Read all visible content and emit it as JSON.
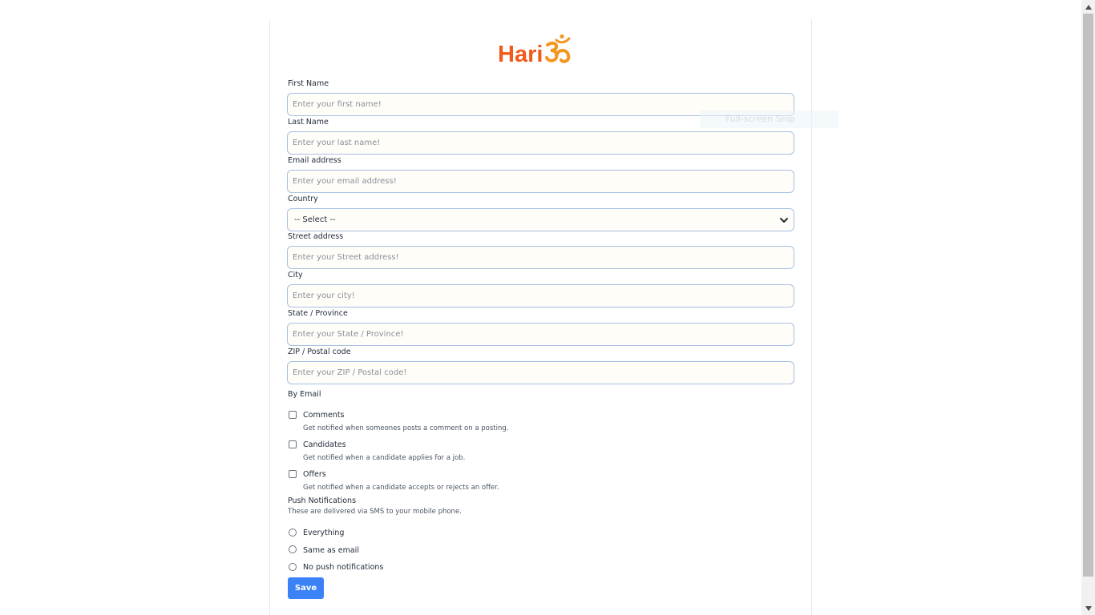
{
  "brand": {
    "name": "Hari",
    "symbol": "om-symbol",
    "color": "#f05a1a",
    "symbol_color": "#f4961e"
  },
  "form": {
    "first_name": {
      "label": "First Name",
      "placeholder": "Enter your first name!"
    },
    "last_name": {
      "label": "Last Name",
      "placeholder": "Enter your last name!"
    },
    "email": {
      "label": "Email address",
      "placeholder": "Enter your email address!"
    },
    "country": {
      "label": "Country",
      "selected": "-- Select --"
    },
    "street": {
      "label": "Street address",
      "placeholder": "Enter your Street address!"
    },
    "city": {
      "label": "City",
      "placeholder": "Enter your city!"
    },
    "state": {
      "label": "State / Province",
      "placeholder": "Enter your State / Province!"
    },
    "zip": {
      "label": "ZIP / Postal code",
      "placeholder": "Enter your ZIP / Postal code!"
    }
  },
  "by_email": {
    "title": "By Email",
    "options": [
      {
        "label": "Comments",
        "description": "Get notified when someones posts a comment on a posting.",
        "checked": false
      },
      {
        "label": "Candidates",
        "description": "Get notified when a candidate applies for a job.",
        "checked": false
      },
      {
        "label": "Offers",
        "description": "Get notified when a candidate accepts or rejects an offer.",
        "checked": false
      }
    ]
  },
  "push": {
    "title": "Push Notifications",
    "subtitle": "These are delivered via SMS to your mobile phone.",
    "options": [
      {
        "label": "Everything",
        "selected": false
      },
      {
        "label": "Same as email",
        "selected": false
      },
      {
        "label": "No push notifications",
        "selected": false
      }
    ]
  },
  "save_label": "Save",
  "overlay": {
    "text": "Full-screen Snip"
  },
  "colors": {
    "accent": "#3b82f6",
    "input_border": "#a8bfe3"
  }
}
